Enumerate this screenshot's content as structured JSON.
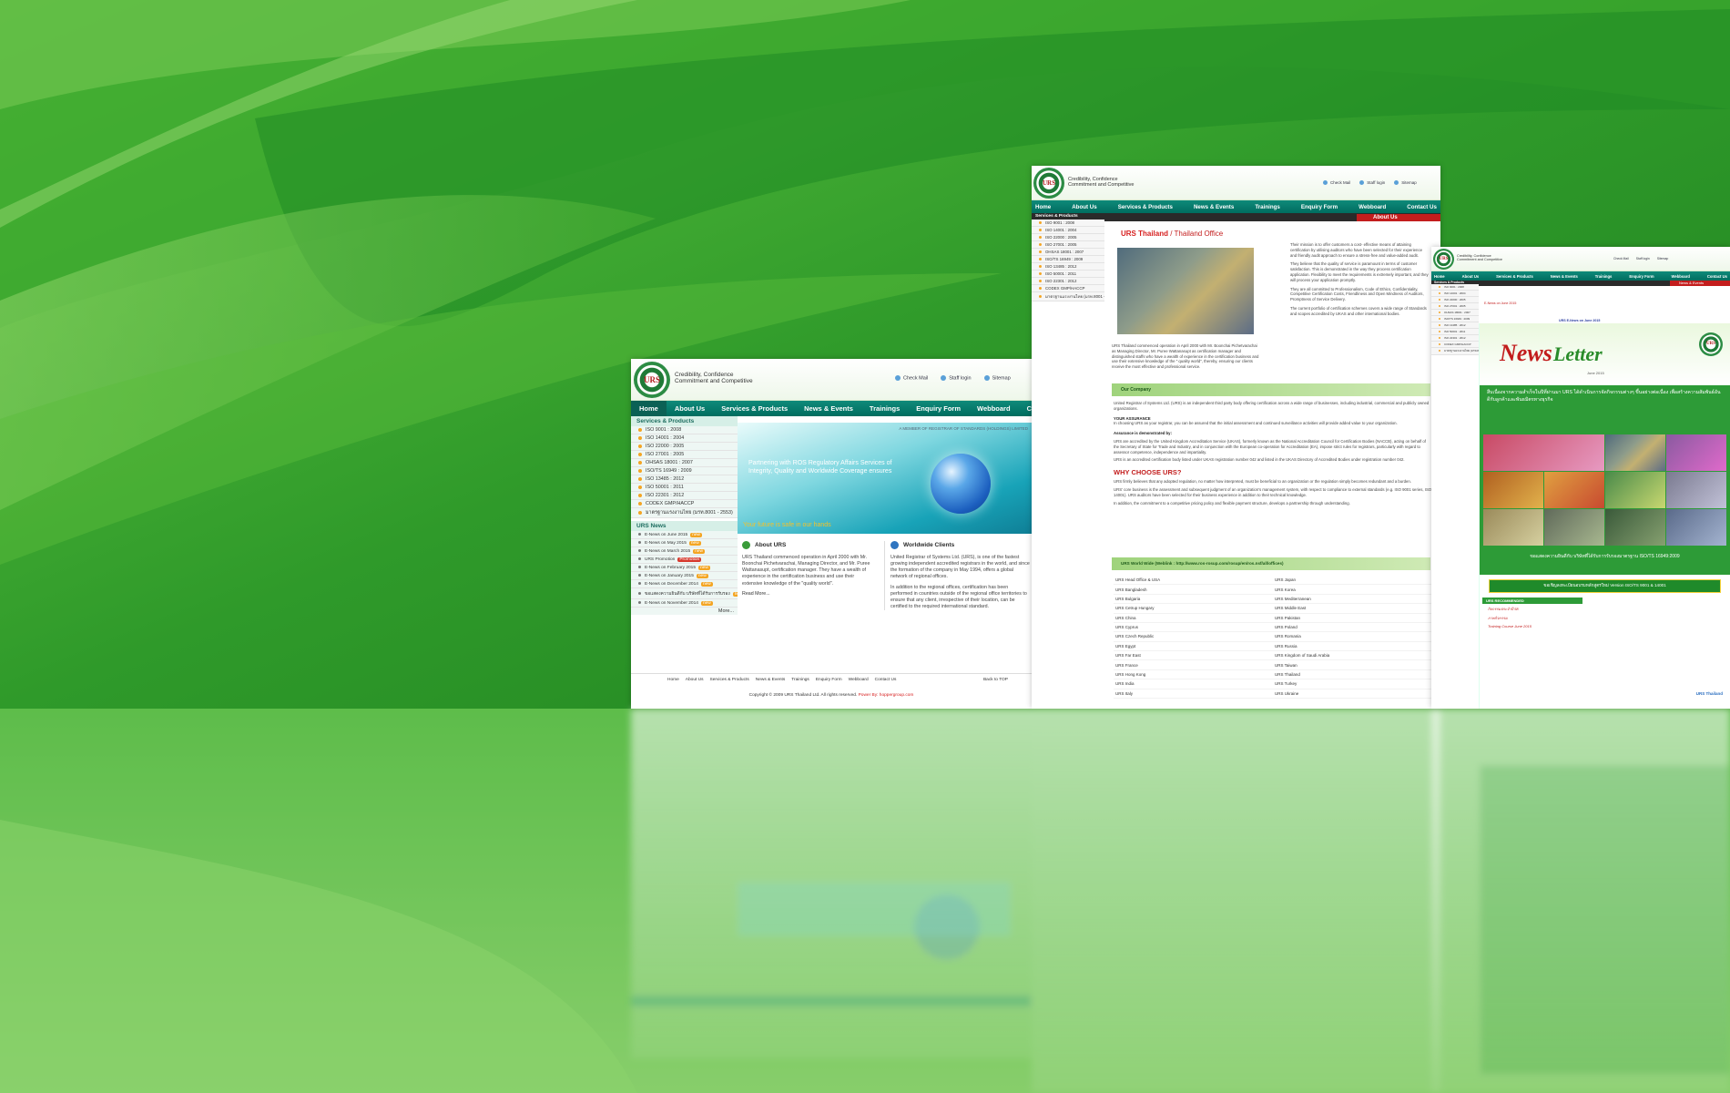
{
  "colors": {
    "accent": "#0f8a7a",
    "brand_green": "#2c9c3a",
    "news_red": "#d72020",
    "badge": "#f4a523"
  },
  "site": {
    "tagline_1": "Credibility, Confidence",
    "tagline_2": "Commitment and Competitive",
    "logo_text": "URS",
    "top_links": [
      "Check Mail",
      "Staff login",
      "Sitemap"
    ],
    "nav": [
      "Home",
      "About Us",
      "Services & Products",
      "News & Events",
      "Trainings",
      "Enquiry Form",
      "Webboard",
      "Contact Us"
    ]
  },
  "left": {
    "services_title": "Services & Products",
    "services": [
      "ISO 9001 : 2008",
      "ISO 14001 : 2004",
      "ISO 22000 : 2005",
      "ISO 27001 : 2005",
      "OHSAS 18001 : 2007",
      "ISO/TS 16949 : 2009",
      "ISO 13485 : 2012",
      "ISO 50001 : 2011",
      "ISO 22301 : 2012",
      "CODEX GMP/HACCP",
      "มาตรฐานแรงงานไทย (มรท.8001 - 2553)"
    ],
    "banner_member": "A MEMBER OF REGISTRAR OF STANDARDS (HOLDINGS) LIMITED",
    "banner_line1": "Partnering with ROS Regulatory Affairs Services of",
    "banner_line2": "Integrity, Quality and Worldwide Coverage ensures",
    "banner_future": "Your future is safe in our hands",
    "news_title": "URS News",
    "news": [
      {
        "t": "E-News on June 2015",
        "b": "new"
      },
      {
        "t": "E-News on May 2015",
        "b": "new"
      },
      {
        "t": "E-News on March 2015",
        "b": "new"
      },
      {
        "t": "URS Promotion",
        "b": "Promotion"
      },
      {
        "t": "E-News on February 2015",
        "b": "new"
      },
      {
        "t": "E-News on January 2015",
        "b": "new"
      },
      {
        "t": "E-News on December 2014",
        "b": "new"
      },
      {
        "t": "ขอแสดงความยินดีกับ บริษัทที่ได้รับการรับรอง",
        "b": "new"
      },
      {
        "t": "E-News on November 2014",
        "b": "new"
      }
    ],
    "more": "More...",
    "about_title": "About URS",
    "about_text": "URS Thailand commenced operation in April 2000 with Mr. Boonchai Pichetvarachai, Managing Director, and Mr. Puree Wattanasupt, certification manager. They have a wealth of experience in the certification business and use their extensive knowledge of the \"quality world\".",
    "read_more": "Read More...",
    "clients_title": "Worldwide Clients",
    "clients_text": "United Registrar of Systems Ltd. (URS), is one of the fastest growing independent accredited registrars in the world, and since the formation of the company in May 1994, offers a global network of regional offices.",
    "clients_text2": "In addition to the regional offices, certification has been performed in countries outside of the regional office territories to ensure that any client, irrespective of their location, can be certified to the required international standard.",
    "footer_links": [
      "Home",
      "About Us",
      "Services & Products",
      "News & Events",
      "Trainings",
      "Enquiry Form",
      "Webboard",
      "Contact Us"
    ],
    "back_to_top": "Back to TOP",
    "copyright": "Copyright © 2009 URS Thailand Ltd. All rights reserved.",
    "powered": "Power By: hoppergroup.com"
  },
  "middle": {
    "side_title": "Services & Products",
    "header_right": "About Us",
    "title_red": "URS Thailand",
    "title_rest": " / Thailand Office",
    "photo_caption": "URS Thailand commenced operation in April 2000 with Mr. Boonchai Pichetvarachai as Managing Director, Mr. Puree Wattanasupt as certification manager and distinguished staffs who have a wealth of experience in the certification business and use their extensive knowledge of the \" quality world\", thereby, ensuring our clients receive the most effective and professional service.",
    "mission": "Their mission is to offer customers a cost- effective means of attaining certification by utilising auditors who have been selected for their experience and friendly audit approach to ensure a stress-free and value-added audit.",
    "quality": "They believe that the quality of service is paramount in terms of customer satisfaction. This is demonstrated in the way they process certification application. Flexibility to meet the requirements is extremely important, and they will process your application promptly.",
    "principles": "They are all committed to Professionalism, Code of Ethics, Confidentiality, Competitive Certification Costs, Friendliness and Open Mindness of Auditors, Promptness of Service Delivery.",
    "portfolio": "The current portfolio of certification schemes covers a wide range of Standards and scopes accredited by UKAS and other international bodies.",
    "our_company": "Our Company",
    "company_text": "United Registrar of Systems Ltd. (URS) is an independent third party body offering certification across a wide range of businesses, including industrial, commercial and publicly owned organizations.",
    "assurance_h": "YOUR ASSURANCE",
    "assurance_text": "In choosing URS as your registrar, you can be assured that the initial assessment and continued surveillance activities will provide added value to your organization.",
    "demonstrated_h": "Assurance is demonstrated by:",
    "demonstrated_text": "URS are accredited by the United Kingdom Accreditation Service (UKAS), formerly known as the National Accreditation Council for Certification Bodies (NACCB), acting on behalf of the Secretary of State for Trade and Industry, and in conjunction with the European co-operation for Accreditation (EA), impose strict rules for registrars, particularly with regard to assessor competence, independence and impartiality.",
    "ukas_text": "URS is an accredited certification body listed under UKAS registration number 042 and listed in the UKAS Directory of Accredited Bodies under registration number 042.",
    "why_h": "WHY CHOOSE URS?",
    "why_text": "URS firmly believes that any adopted regulation, no matter how interpreted, must be beneficial to an organization or the regulation simply becomes redundant and a burden.",
    "why_text2": "URS' core business is the assessment and subsequent judgment of an organization's management system, with respect to compliance to external standards (e.g. ISO 9001 series, ISO 14001). URS auditors have been selected for their business experience in addition to their technical knowledge.",
    "why_text3": "In addition, the commitment to a competitive pricing policy and flexible payment structure, develops a partnership through understanding.",
    "worldwide_bar": "URS World Wide (Weblink : http://www.ros-rosup.com/rosup/en/ros.nsf/all/offices)",
    "offices_left": [
      "URS Head Office & USA",
      "URS Bangladesh",
      "URS Bulgaria",
      "URS Cetrup Hungary",
      "URS China",
      "URS Cyprus",
      "URS Czech Republic",
      "URS Egypt",
      "URS Far East",
      "URS France",
      "URS Hong Kong",
      "URS India",
      "URS Italy"
    ],
    "offices_right": [
      "URS Japan",
      "URS Korea",
      "URS Mediterranean",
      "URS Middle East",
      "URS Pakistan",
      "URS Poland",
      "URS Romania",
      "URS Russia",
      "URS Kingdom of Saudi Arabia",
      "URS Taiwan",
      "URS Thailand",
      "URS Turkey",
      "URS Ukraine"
    ]
  },
  "right": {
    "breadcrumb": "E-News on June 2015",
    "header_right": "News & Events",
    "subtitle": "URS E-News on June 2015",
    "news_word": "News",
    "letter_word": "Letter",
    "issue": "June 2015",
    "intro": "สืบเนื่องจากความสำเร็จในปีที่ผ่านมา URS ได้ดำเนินการจัดกิจกรรมต่างๆ ขึ้นอย่างต่อเนื่อง เพื่อสร้างความสัมพันธ์อันดีกับลูกค้าและพันธมิตรทางธุรกิจ",
    "caption": "ขอแสดงความยินดีกับ บริษัทที่ได้รับการรับรองมาตรฐาน ISO/TS 16949:2009",
    "promo": "ขอเชิญลงทะเบียนอบรมหลักสูตรใหม่ Version ISO/TS 9001 & 14001",
    "recommended_title": "URS RECOMMENDED",
    "recommended": [
      "กิจกรรมประจำปี 58",
      "ภาพกิจกรรม",
      "Training Course June 2015"
    ],
    "footer_brand": "URS Thailand"
  }
}
